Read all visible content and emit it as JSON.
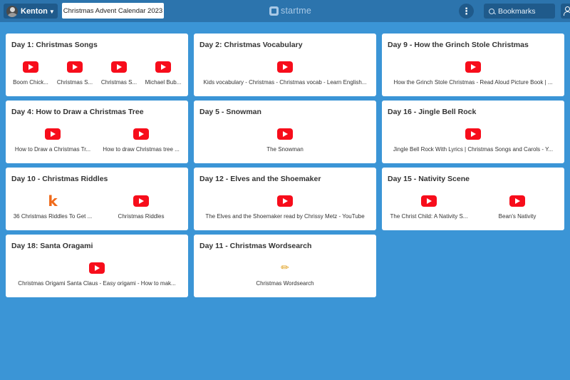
{
  "header": {
    "user_name": "Kenton",
    "page_tab": "Christmas Advent Calendar 2023",
    "logo_text": "startme",
    "menu_glyph": "⋮",
    "search_placeholder": "Bookmarks"
  },
  "colors": {
    "background": "#3b95d6",
    "topbar": "#2c74ad",
    "youtube_red": "#f70d1b"
  },
  "cards": [
    {
      "title": "Day 1: Christmas Songs",
      "links": [
        {
          "icon": "youtube-icon",
          "label": "Boom Chick..."
        },
        {
          "icon": "youtube-icon",
          "label": "Christmas S..."
        },
        {
          "icon": "youtube-icon",
          "label": "Christmas S..."
        },
        {
          "icon": "youtube-icon",
          "label": "Michael Bub..."
        }
      ]
    },
    {
      "title": "Day 2: Christmas Vocabulary",
      "links": [
        {
          "icon": "youtube-icon",
          "label": "Kids vocabulary - Christmas - Christmas vocab - Learn English..."
        }
      ]
    },
    {
      "title": "Day 9 - How the Grinch Stole Christmas",
      "links": [
        {
          "icon": "youtube-icon",
          "label": "How the Grinch Stole Christmas - Read Aloud Picture Book | ..."
        }
      ]
    },
    {
      "title": "Day 4: How to Draw a Christmas Tree",
      "links": [
        {
          "icon": "youtube-icon",
          "label": "How to Draw a Christmas Tr..."
        },
        {
          "icon": "youtube-icon",
          "label": "How to draw Christmas tree ..."
        }
      ]
    },
    {
      "title": "Day 5 - Snowman",
      "links": [
        {
          "icon": "youtube-icon",
          "label": "The Snowman"
        }
      ]
    },
    {
      "title": "Day 16 - Jingle Bell Rock",
      "links": [
        {
          "icon": "youtube-icon",
          "label": "Jingle Bell Rock With Lyrics | Christmas Songs and Carols - Y..."
        }
      ]
    },
    {
      "title": "Day 10 - Christmas Riddles",
      "links": [
        {
          "icon": "kizi-k-icon",
          "glyph": "k",
          "label": "36 Christmas Riddles To Get ..."
        },
        {
          "icon": "youtube-icon",
          "label": "Christmas Riddles"
        }
      ]
    },
    {
      "title": "Day 12 - Elves and the Shoemaker",
      "links": [
        {
          "icon": "youtube-icon",
          "label": "The Elves and the Shoemaker read by Chrissy Metz - YouTube"
        }
      ]
    },
    {
      "title": "Day 15 - Nativity Scene",
      "links": [
        {
          "icon": "youtube-icon",
          "label": "The Christ Child: A Nativity S..."
        },
        {
          "icon": "youtube-icon",
          "label": "Bean's Nativity"
        }
      ]
    },
    {
      "title": "Day 18: Santa Oragami",
      "links": [
        {
          "icon": "youtube-icon",
          "label": "Christmas Origami Santa Claus - Easy origami - How to mak..."
        }
      ]
    },
    {
      "title": "Day 11 - Christmas Wordsearch",
      "links": [
        {
          "icon": "pencil-icon",
          "glyph": "✏",
          "label": "Christmas Wordsearch"
        }
      ]
    }
  ]
}
